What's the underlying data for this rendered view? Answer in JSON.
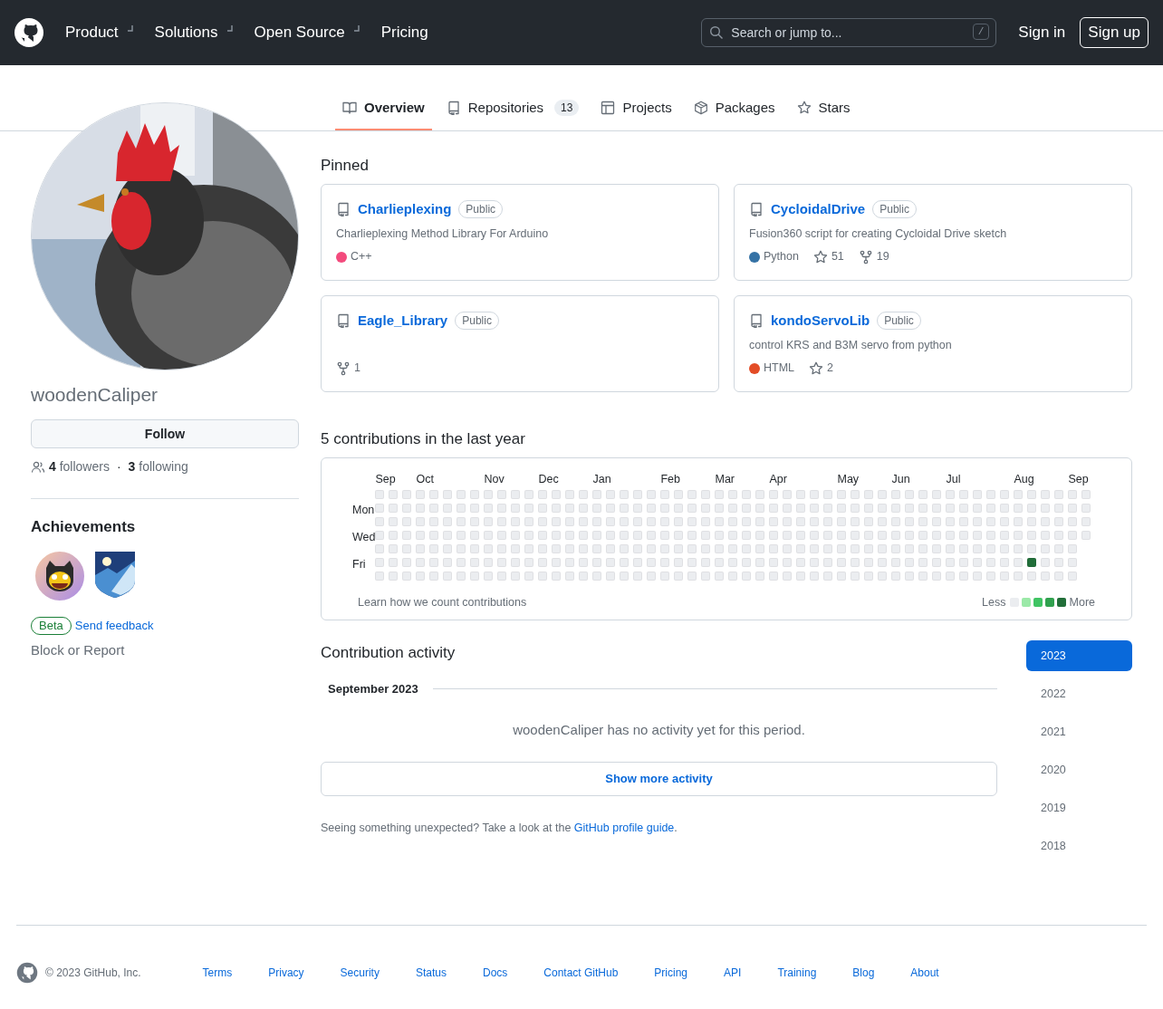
{
  "header": {
    "nav": [
      {
        "label": "Product",
        "dropdown": true
      },
      {
        "label": "Solutions",
        "dropdown": true
      },
      {
        "label": "Open Source",
        "dropdown": true
      },
      {
        "label": "Pricing",
        "dropdown": false
      }
    ],
    "search": {
      "placeholder": "Search or jump to...",
      "shortcut": "/"
    },
    "sign_in": "Sign in",
    "sign_up": "Sign up"
  },
  "tabs": [
    {
      "label": "Overview",
      "selected": true
    },
    {
      "label": "Repositories",
      "count": "13",
      "selected": false
    },
    {
      "label": "Projects",
      "selected": false
    },
    {
      "label": "Packages",
      "selected": false
    },
    {
      "label": "Stars",
      "selected": false
    }
  ],
  "profile": {
    "username": "woodenCaliper",
    "follow": "Follow",
    "followers_count": "4",
    "followers_label": "followers",
    "separator": "·",
    "following_count": "3",
    "following_label": "following",
    "achievements_title": "Achievements",
    "achievements": [
      {
        "kind": "starstruck"
      },
      {
        "kind": "arctic"
      }
    ],
    "beta": "Beta",
    "send_feedback": "Send feedback",
    "block": "Block or Report"
  },
  "pinned": {
    "title": "Pinned",
    "repos": [
      {
        "name": "Charlieplexing",
        "visibility": "Public",
        "description": "Charlieplexing Method Library For Arduino",
        "language": "C++",
        "color": "#f34b7d"
      },
      {
        "name": "CycloidalDrive",
        "visibility": "Public",
        "description": "Fusion360 script for creating Cycloidal Drive sketch",
        "language": "Python",
        "color": "#3572a5",
        "stars": "51",
        "forks": "19"
      },
      {
        "name": "Eagle_Library",
        "visibility": "Public",
        "forks": "1"
      },
      {
        "name": "kondoServoLib",
        "visibility": "Public",
        "description": "control KRS and B3M servo from python",
        "language": "HTML",
        "color": "#e34c26",
        "stars": "2"
      }
    ]
  },
  "contributions": {
    "title": "5 contributions in the last year",
    "day_labels": [
      "Mon",
      "Wed",
      "Fri"
    ],
    "weeks": [
      {
        "month": "Sep",
        "active": [
          false,
          false,
          false,
          false,
          false,
          false,
          false
        ]
      },
      {
        "active": [
          false,
          false,
          false,
          false,
          false,
          false,
          false
        ]
      },
      {
        "active": [
          false,
          false,
          false,
          false,
          false,
          false,
          false
        ]
      },
      {
        "month": "Oct",
        "active": [
          false,
          false,
          false,
          false,
          false,
          false,
          false
        ]
      },
      {
        "active": [
          false,
          false,
          false,
          false,
          false,
          false,
          false
        ]
      },
      {
        "active": [
          false,
          false,
          false,
          false,
          false,
          false,
          false
        ]
      },
      {
        "active": [
          false,
          false,
          false,
          false,
          false,
          false,
          false
        ]
      },
      {
        "active": [
          false,
          false,
          false,
          false,
          false,
          false,
          false
        ]
      },
      {
        "month": "Nov",
        "active": [
          false,
          false,
          false,
          false,
          false,
          false,
          false
        ]
      },
      {
        "active": [
          false,
          false,
          false,
          false,
          false,
          false,
          false
        ]
      },
      {
        "active": [
          false,
          false,
          false,
          false,
          false,
          false,
          false
        ]
      },
      {
        "active": [
          false,
          false,
          false,
          false,
          false,
          false,
          false
        ]
      },
      {
        "month": "Dec",
        "active": [
          false,
          false,
          false,
          false,
          false,
          false,
          false
        ]
      },
      {
        "active": [
          false,
          false,
          false,
          false,
          false,
          false,
          false
        ]
      },
      {
        "active": [
          false,
          false,
          false,
          false,
          false,
          false,
          false
        ]
      },
      {
        "active": [
          false,
          false,
          false,
          false,
          false,
          false,
          false
        ]
      },
      {
        "month": "Jan",
        "active": [
          false,
          false,
          false,
          false,
          false,
          false,
          false
        ]
      },
      {
        "active": [
          false,
          false,
          false,
          false,
          false,
          false,
          false
        ]
      },
      {
        "active": [
          false,
          false,
          false,
          false,
          false,
          false,
          false
        ]
      },
      {
        "active": [
          false,
          false,
          false,
          false,
          false,
          false,
          false
        ]
      },
      {
        "active": [
          false,
          false,
          false,
          false,
          false,
          false,
          false
        ]
      },
      {
        "month": "Feb",
        "active": [
          false,
          false,
          false,
          false,
          false,
          false,
          false
        ]
      },
      {
        "active": [
          false,
          false,
          false,
          false,
          false,
          false,
          false
        ]
      },
      {
        "active": [
          false,
          false,
          false,
          false,
          false,
          false,
          false
        ]
      },
      {
        "active": [
          false,
          false,
          false,
          false,
          false,
          false,
          false
        ]
      },
      {
        "month": "Mar",
        "active": [
          false,
          false,
          false,
          false,
          false,
          false,
          false
        ]
      },
      {
        "active": [
          false,
          false,
          false,
          false,
          false,
          false,
          false
        ]
      },
      {
        "active": [
          false,
          false,
          false,
          false,
          false,
          false,
          false
        ]
      },
      {
        "active": [
          false,
          false,
          false,
          false,
          false,
          false,
          false
        ]
      },
      {
        "month": "Apr",
        "active": [
          false,
          false,
          false,
          false,
          false,
          false,
          false
        ]
      },
      {
        "active": [
          false,
          false,
          false,
          false,
          false,
          false,
          false
        ]
      },
      {
        "active": [
          false,
          false,
          false,
          false,
          false,
          false,
          false
        ]
      },
      {
        "active": [
          false,
          false,
          false,
          false,
          false,
          false,
          false
        ]
      },
      {
        "active": [
          false,
          false,
          false,
          false,
          false,
          false,
          false
        ]
      },
      {
        "month": "May",
        "active": [
          false,
          false,
          false,
          false,
          false,
          false,
          false
        ]
      },
      {
        "active": [
          false,
          false,
          false,
          false,
          false,
          false,
          false
        ]
      },
      {
        "active": [
          false,
          false,
          false,
          false,
          false,
          false,
          false
        ]
      },
      {
        "active": [
          false,
          false,
          false,
          false,
          false,
          false,
          false
        ]
      },
      {
        "month": "Jun",
        "active": [
          false,
          false,
          false,
          false,
          false,
          false,
          false
        ]
      },
      {
        "active": [
          false,
          false,
          false,
          false,
          false,
          false,
          false
        ]
      },
      {
        "active": [
          false,
          false,
          false,
          false,
          false,
          false,
          false
        ]
      },
      {
        "active": [
          false,
          false,
          false,
          false,
          false,
          false,
          false
        ]
      },
      {
        "month": "Jul",
        "active": [
          false,
          false,
          false,
          false,
          false,
          false,
          false
        ]
      },
      {
        "active": [
          false,
          false,
          false,
          false,
          false,
          false,
          false
        ]
      },
      {
        "active": [
          false,
          false,
          false,
          false,
          false,
          false,
          false
        ]
      },
      {
        "active": [
          false,
          false,
          false,
          false,
          false,
          false,
          false
        ]
      },
      {
        "active": [
          false,
          false,
          false,
          false,
          false,
          false,
          false
        ]
      },
      {
        "month": "Aug",
        "active": [
          false,
          false,
          false,
          false,
          false,
          false,
          false
        ]
      },
      {
        "active": [
          false,
          false,
          false,
          false,
          false,
          true,
          false
        ]
      },
      {
        "active": [
          false,
          false,
          false,
          false,
          false,
          false,
          false
        ]
      },
      {
        "active": [
          false,
          false,
          false,
          false,
          false,
          false,
          false
        ]
      },
      {
        "month": "Sep",
        "active": [
          false,
          false,
          false,
          false,
          false,
          false,
          false
        ]
      },
      {
        "active": [
          false,
          false,
          false,
          false
        ]
      }
    ],
    "learn": "Learn how we count contributions",
    "less": "Less",
    "more": "More",
    "legend": [
      {
        "color": "#ebedf0"
      },
      {
        "color": "#9be9a8"
      },
      {
        "color": "#40c463"
      },
      {
        "color": "#30a14e"
      },
      {
        "color": "#216e39"
      }
    ]
  },
  "activity": {
    "title": "Contribution activity",
    "month": "September 2023",
    "empty": "woodenCaliper has no activity yet for this period.",
    "show_more": "Show more activity",
    "hint": "Seeing something unexpected? Take a look at the",
    "hint_link": "GitHub profile guide",
    "hint_end": ".",
    "years": [
      {
        "label": "2023",
        "selected": true
      },
      {
        "label": "2022",
        "selected": false
      },
      {
        "label": "2021",
        "selected": false
      },
      {
        "label": "2020",
        "selected": false
      },
      {
        "label": "2019",
        "selected": false
      },
      {
        "label": "2018",
        "selected": false
      }
    ]
  },
  "footer": {
    "copyright": "© 2023 GitHub, Inc.",
    "links": [
      "Terms",
      "Privacy",
      "Security",
      "Status",
      "Docs",
      "Contact GitHub",
      "Pricing",
      "API",
      "Training",
      "Blog",
      "About"
    ]
  }
}
